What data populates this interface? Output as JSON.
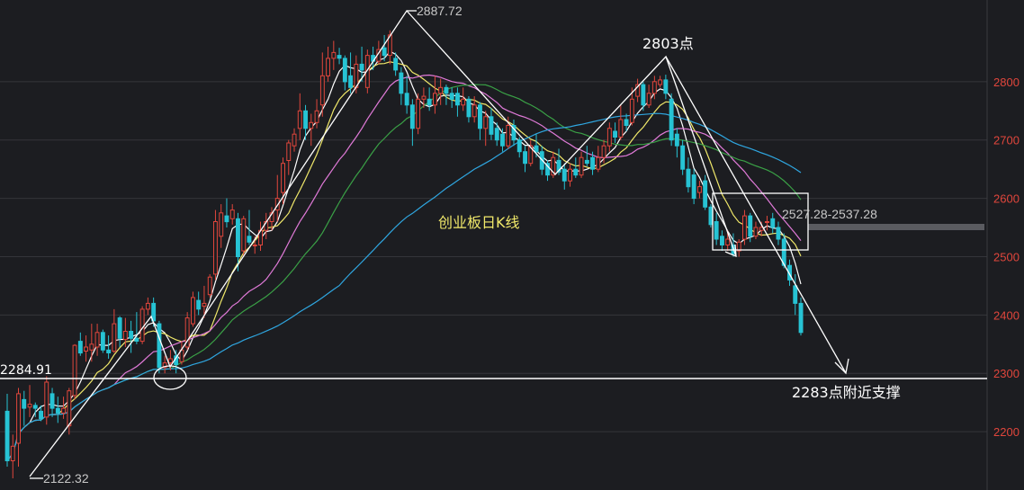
{
  "chart_data": {
    "type": "candlestick",
    "title": "创业板日K线",
    "ylim": [
      2100,
      2940
    ],
    "y_ticks": [
      2200,
      2300,
      2400,
      2500,
      2600,
      2700,
      2800
    ],
    "y_tick_labels": [
      "2200",
      "2300",
      "2400",
      "2500",
      "2600",
      "2700",
      "2800"
    ],
    "grid": true,
    "colors": {
      "up": "#e0463c",
      "down": "#27c3d4",
      "background": "#1c1d21"
    },
    "annotations": {
      "high_label": "2887.72",
      "high_value": 2887.72,
      "low_label": "2122.32",
      "low_value": 2122.32,
      "left_label": "2284.91",
      "left_value": 2284.91,
      "peak_label": "2803点",
      "peak_value": 2803,
      "box_label": "2527.28-2537.28",
      "support_label": "2283点附近支撑",
      "support_value": 2283
    },
    "candles": [
      [
        2235,
        2150,
        2265,
        2140
      ],
      [
        2150,
        2175,
        2195,
        2120
      ],
      [
        2180,
        2265,
        2275,
        2140
      ],
      [
        2255,
        2240,
        2270,
        2210
      ],
      [
        2242,
        2247,
        2280,
        2225
      ],
      [
        2245,
        2240,
        2250,
        2225
      ],
      [
        2235,
        2222,
        2245,
        2218
      ],
      [
        2225,
        2285,
        2295,
        2212
      ],
      [
        2265,
        2240,
        2275,
        2225
      ],
      [
        2240,
        2232,
        2260,
        2215
      ],
      [
        2232,
        2240,
        2260,
        2222
      ],
      [
        2210,
        2270,
        2275,
        2195
      ],
      [
        2262,
        2348,
        2350,
        2255
      ],
      [
        2355,
        2335,
        2370,
        2330
      ],
      [
        2338,
        2345,
        2365,
        2320
      ],
      [
        2340,
        2350,
        2385,
        2320
      ],
      [
        2345,
        2370,
        2385,
        2330
      ],
      [
        2370,
        2340,
        2375,
        2335
      ],
      [
        2340,
        2335,
        2365,
        2325
      ],
      [
        2338,
        2385,
        2410,
        2335
      ],
      [
        2395,
        2360,
        2398,
        2345
      ],
      [
        2358,
        2372,
        2395,
        2345
      ],
      [
        2372,
        2360,
        2390,
        2335
      ],
      [
        2360,
        2355,
        2405,
        2350
      ],
      [
        2355,
        2410,
        2415,
        2350
      ],
      [
        2410,
        2420,
        2430,
        2400
      ],
      [
        2420,
        2390,
        2430,
        2380
      ],
      [
        2385,
        2310,
        2390,
        2300
      ],
      [
        2310,
        2318,
        2330,
        2300
      ],
      [
        2318,
        2325,
        2340,
        2305
      ],
      [
        2330,
        2315,
        2340,
        2300
      ],
      [
        2320,
        2340,
        2355,
        2315
      ],
      [
        2345,
        2395,
        2405,
        2340
      ],
      [
        2385,
        2430,
        2440,
        2380
      ],
      [
        2425,
        2410,
        2440,
        2400
      ],
      [
        2415,
        2420,
        2450,
        2395
      ],
      [
        2435,
        2465,
        2470,
        2430
      ],
      [
        2470,
        2560,
        2580,
        2460
      ],
      [
        2535,
        2575,
        2590,
        2515
      ],
      [
        2570,
        2560,
        2600,
        2550
      ],
      [
        2565,
        2580,
        2590,
        2555
      ],
      [
        2565,
        2500,
        2575,
        2475
      ],
      [
        2510,
        2565,
        2570,
        2500
      ],
      [
        2535,
        2525,
        2580,
        2520
      ],
      [
        2520,
        2520,
        2535,
        2505
      ],
      [
        2520,
        2545,
        2560,
        2510
      ],
      [
        2545,
        2560,
        2575,
        2530
      ],
      [
        2560,
        2575,
        2585,
        2545
      ],
      [
        2580,
        2600,
        2640,
        2560
      ],
      [
        2610,
        2660,
        2670,
        2590
      ],
      [
        2665,
        2695,
        2700,
        2640
      ],
      [
        2690,
        2710,
        2720,
        2680
      ],
      [
        2720,
        2750,
        2780,
        2700
      ],
      [
        2750,
        2720,
        2760,
        2700
      ],
      [
        2720,
        2730,
        2745,
        2690
      ],
      [
        2730,
        2750,
        2770,
        2720
      ],
      [
        2760,
        2810,
        2850,
        2740
      ],
      [
        2810,
        2840,
        2860,
        2800
      ],
      [
        2840,
        2850,
        2870,
        2820
      ],
      [
        2845,
        2840,
        2858,
        2830
      ],
      [
        2840,
        2800,
        2845,
        2785
      ],
      [
        2810,
        2790,
        2850,
        2780
      ],
      [
        2790,
        2830,
        2845,
        2780
      ],
      [
        2830,
        2820,
        2860,
        2800
      ],
      [
        2790,
        2845,
        2855,
        2780
      ],
      [
        2845,
        2835,
        2860,
        2820
      ],
      [
        2835,
        2855,
        2870,
        2830
      ],
      [
        2858,
        2845,
        2880,
        2835
      ],
      [
        2845,
        2880,
        2888,
        2830
      ],
      [
        2840,
        2820,
        2850,
        2810
      ],
      [
        2815,
        2780,
        2825,
        2760
      ],
      [
        2780,
        2760,
        2810,
        2745
      ],
      [
        2760,
        2720,
        2770,
        2690
      ],
      [
        2720,
        2770,
        2780,
        2710
      ],
      [
        2770,
        2775,
        2790,
        2755
      ],
      [
        2770,
        2760,
        2790,
        2750
      ],
      [
        2760,
        2780,
        2810,
        2745
      ],
      [
        2780,
        2790,
        2805,
        2760
      ],
      [
        2790,
        2780,
        2795,
        2760
      ],
      [
        2780,
        2770,
        2790,
        2755
      ],
      [
        2780,
        2760,
        2790,
        2740
      ],
      [
        2760,
        2770,
        2790,
        2750
      ],
      [
        2770,
        2740,
        2775,
        2730
      ],
      [
        2740,
        2760,
        2775,
        2730
      ],
      [
        2760,
        2720,
        2765,
        2700
      ],
      [
        2720,
        2740,
        2750,
        2690
      ],
      [
        2740,
        2710,
        2755,
        2700
      ],
      [
        2720,
        2700,
        2730,
        2690
      ],
      [
        2710,
        2690,
        2720,
        2680
      ],
      [
        2690,
        2725,
        2740,
        2685
      ],
      [
        2725,
        2700,
        2735,
        2690
      ],
      [
        2700,
        2680,
        2705,
        2670
      ],
      [
        2680,
        2660,
        2690,
        2645
      ],
      [
        2660,
        2690,
        2700,
        2655
      ],
      [
        2690,
        2680,
        2710,
        2670
      ],
      [
        2680,
        2650,
        2690,
        2640
      ],
      [
        2660,
        2640,
        2665,
        2630
      ],
      [
        2640,
        2670,
        2680,
        2635
      ],
      [
        2665,
        2645,
        2685,
        2640
      ],
      [
        2650,
        2630,
        2660,
        2615
      ],
      [
        2630,
        2650,
        2660,
        2620
      ],
      [
        2650,
        2640,
        2670,
        2635
      ],
      [
        2640,
        2670,
        2680,
        2635
      ],
      [
        2665,
        2660,
        2690,
        2655
      ],
      [
        2670,
        2650,
        2680,
        2640
      ],
      [
        2650,
        2670,
        2690,
        2645
      ],
      [
        2670,
        2690,
        2700,
        2660
      ],
      [
        2690,
        2720,
        2730,
        2680
      ],
      [
        2715,
        2705,
        2730,
        2695
      ],
      [
        2705,
        2735,
        2760,
        2700
      ],
      [
        2735,
        2725,
        2745,
        2715
      ],
      [
        2730,
        2770,
        2790,
        2725
      ],
      [
        2775,
        2795,
        2805,
        2765
      ],
      [
        2795,
        2760,
        2800,
        2750
      ],
      [
        2760,
        2780,
        2795,
        2755
      ],
      [
        2780,
        2800,
        2810,
        2770
      ],
      [
        2795,
        2803,
        2810,
        2790
      ],
      [
        2803,
        2780,
        2812,
        2770
      ],
      [
        2770,
        2700,
        2780,
        2690
      ],
      [
        2710,
        2690,
        2720,
        2670
      ],
      [
        2690,
        2650,
        2700,
        2640
      ],
      [
        2650,
        2620,
        2670,
        2610
      ],
      [
        2640,
        2600,
        2650,
        2590
      ],
      [
        2610,
        2620,
        2630,
        2600
      ],
      [
        2630,
        2585,
        2640,
        2580
      ],
      [
        2585,
        2555,
        2590,
        2550
      ],
      [
        2560,
        2530,
        2575,
        2520
      ],
      [
        2535,
        2520,
        2545,
        2510
      ],
      [
        2520,
        2530,
        2545,
        2510
      ],
      [
        2520,
        2505,
        2540,
        2500
      ],
      [
        2510,
        2525,
        2530,
        2500
      ],
      [
        2530,
        2570,
        2580,
        2520
      ],
      [
        2570,
        2535,
        2575,
        2525
      ],
      [
        2535,
        2550,
        2560,
        2530
      ],
      [
        2545,
        2550,
        2560,
        2535
      ],
      [
        2560,
        2560,
        2570,
        2545
      ],
      [
        2565,
        2550,
        2575,
        2540
      ],
      [
        2550,
        2530,
        2560,
        2520
      ],
      [
        2530,
        2485,
        2540,
        2480
      ],
      [
        2485,
        2460,
        2495,
        2450
      ],
      [
        2450,
        2420,
        2470,
        2400
      ],
      [
        2420,
        2370,
        2430,
        2365
      ]
    ]
  }
}
